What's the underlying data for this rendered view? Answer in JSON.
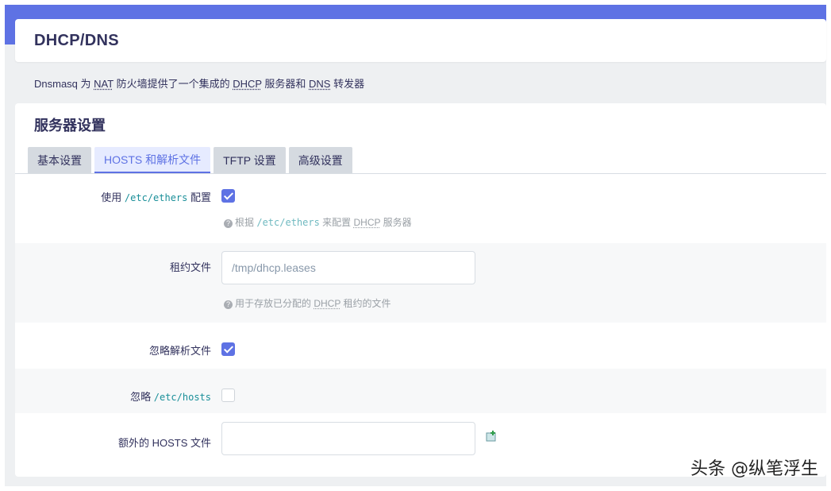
{
  "header": {
    "title": "DHCP/DNS"
  },
  "description": {
    "prefix": "Dnsmasq 为 ",
    "nat": "NAT",
    "mid1": " 防火墙提供了一个集成的 ",
    "dhcp": "DHCP",
    "mid2": " 服务器和 ",
    "dns": "DNS",
    "suffix": " 转发器"
  },
  "section": {
    "title": "服务器设置",
    "tabs": [
      {
        "label": "基本设置",
        "active": false
      },
      {
        "label": "HOSTS 和解析文件",
        "active": true
      },
      {
        "label": "TFTP 设置",
        "active": false
      },
      {
        "label": "高级设置",
        "active": false
      }
    ]
  },
  "fields": {
    "use_ethers": {
      "label_prefix": "使用 ",
      "label_code": "/etc/ethers",
      "label_suffix": " 配置",
      "checked": true,
      "help_prefix": "根据 ",
      "help_code": "/etc/ethers",
      "help_mid": " 来配置 ",
      "help_abbr": "DHCP",
      "help_suffix": " 服务器"
    },
    "lease_file": {
      "label": "租约文件",
      "value": "/tmp/dhcp.leases",
      "help_prefix": "用于存放已分配的 ",
      "help_abbr": "DHCP",
      "help_suffix": " 租约的文件"
    },
    "ignore_resolv": {
      "label": "忽略解析文件",
      "checked": true
    },
    "ignore_hosts": {
      "label_prefix": "忽略 ",
      "label_code": "/etc/hosts",
      "checked": false
    },
    "extra_hosts": {
      "label": "额外的 HOSTS 文件",
      "value": ""
    }
  },
  "watermark": "头条 @纵笔浮生",
  "colors": {
    "accent": "#5e72e4",
    "title": "#32325d"
  }
}
